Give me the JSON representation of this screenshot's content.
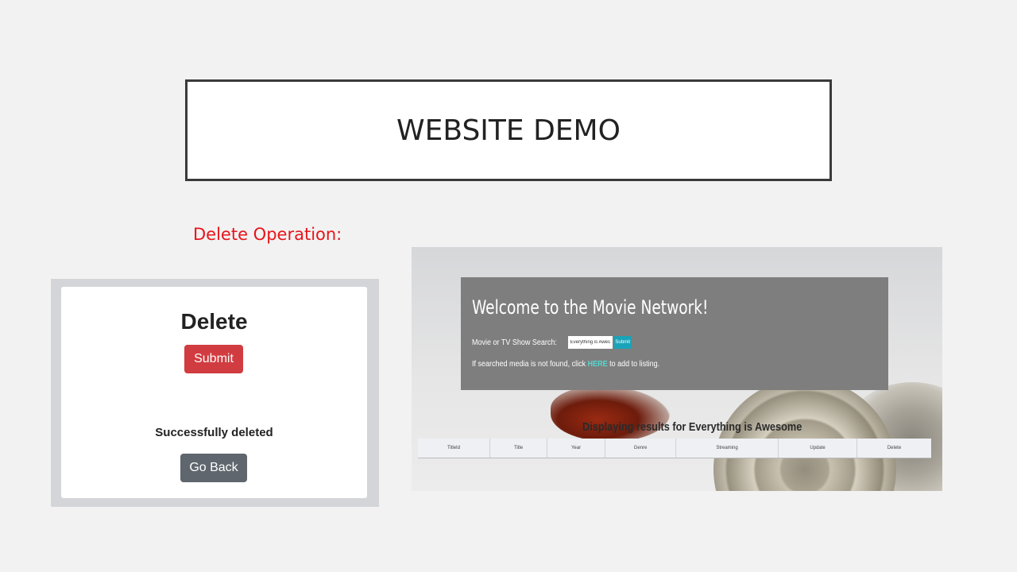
{
  "slide": {
    "title": "WEBSITE DEMO",
    "section_label": "Delete Operation:"
  },
  "delete_page": {
    "heading": "Delete",
    "submit_label": "Submit",
    "message": "Successfully deleted",
    "back_label": "Go Back"
  },
  "movie_site": {
    "welcome": "Welcome to the Movie Network!",
    "search_label": "Movie or TV Show Search:",
    "search_value": "Everything is Awesome",
    "search_button": "Submit",
    "notfound_prefix": "If searched media is not found, click ",
    "notfound_link": "HERE",
    "notfound_suffix": " to add to listing.",
    "results_heading": "Displaying results for Everything is Awesome",
    "columns": [
      "TitleId",
      "Title",
      "Year",
      "Genre",
      "Streaming",
      "Update",
      "Delete"
    ]
  },
  "colors": {
    "accent_red": "#e8141b",
    "submit_red": "#d13c40",
    "back_gray": "#5f666d",
    "search_teal": "#19a3b8"
  }
}
